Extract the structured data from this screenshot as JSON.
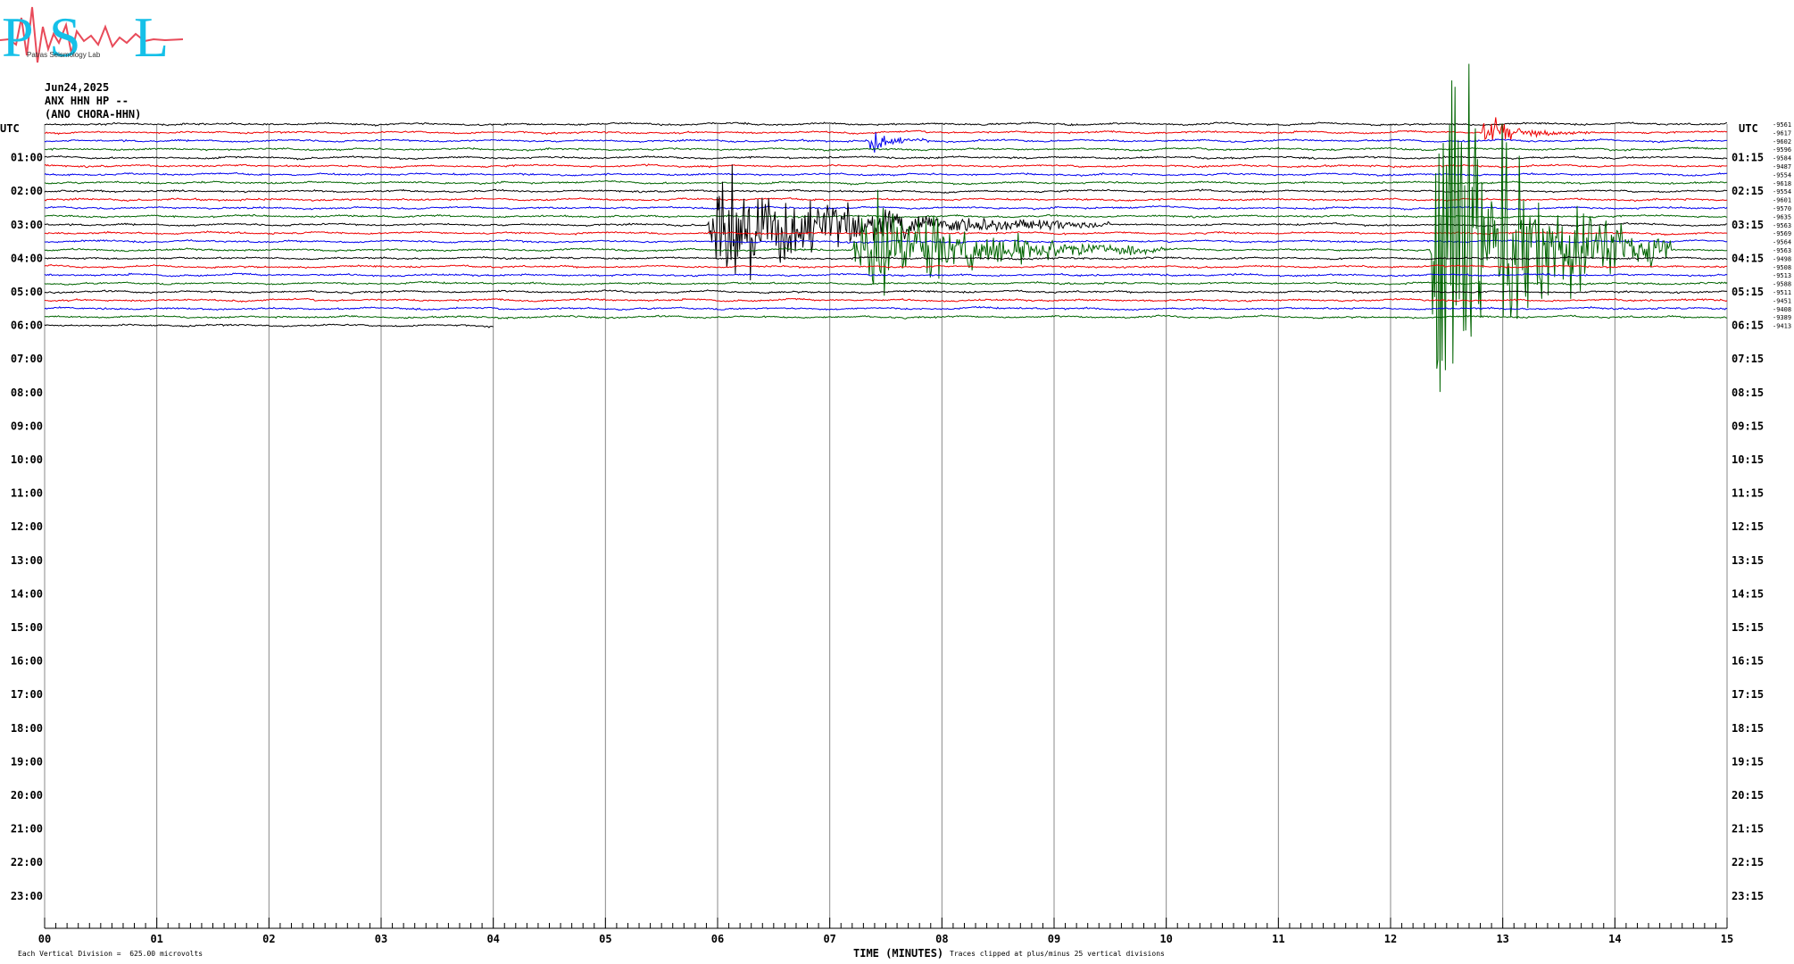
{
  "logo": {
    "letters": [
      "P",
      "S",
      "L"
    ],
    "caption": "Patras Seismology Lab",
    "colors": {
      "letters": "#15c0e8",
      "seismogram": "#e84b5a"
    }
  },
  "header": {
    "date": "Jun24,2025",
    "station_line": "ANX HHN HP --",
    "station_name": "(ANO CHORA-HHN)",
    "utc_label": "UTC"
  },
  "footer": {
    "scale_note": "Each Vertical Division =  625.00 microvolts",
    "xaxis_title": "TIME (MINUTES)",
    "clip_note": "Traces clipped at plus/minus 25 vertical divisions"
  },
  "chart_data": {
    "type": "line",
    "title": "",
    "xlabel": "TIME (MINUTES)",
    "xlim": [
      0,
      15
    ],
    "x_ticks": [
      "00",
      "01",
      "02",
      "03",
      "04",
      "05",
      "06",
      "07",
      "08",
      "09",
      "10",
      "11",
      "12",
      "13",
      "14",
      "15"
    ],
    "left_hour_labels": [
      "01:00",
      "02:00",
      "03:00",
      "04:00",
      "05:00",
      "06:00",
      "07:00",
      "08:00",
      "09:00",
      "10:00",
      "11:00",
      "12:00",
      "13:00",
      "14:00",
      "15:00",
      "16:00",
      "17:00",
      "18:00",
      "19:00",
      "20:00",
      "21:00",
      "22:00",
      "23:00"
    ],
    "right_hour_labels": [
      "01:15",
      "02:15",
      "03:15",
      "04:15",
      "05:15",
      "06:15",
      "07:15",
      "08:15",
      "09:15",
      "10:15",
      "11:15",
      "12:15",
      "13:15",
      "14:15",
      "15:15",
      "16:15",
      "17:15",
      "18:15",
      "19:15",
      "20:15",
      "21:15",
      "22:15",
      "23:15"
    ],
    "trace_colors": [
      "#000000",
      "#ee0000",
      "#0000ee",
      "#006400"
    ],
    "trace_count": 25,
    "last_trace_end_minute": 4.0,
    "trace_means": [
      "-9561",
      "-9617",
      "-9602",
      "-9596",
      "-9584",
      "-9487",
      "-9554",
      "-9618",
      "-9554",
      "-9601",
      "-9570",
      "-9635",
      "-9563",
      "-9569",
      "-9564",
      "-9563",
      "-9498",
      "-9508",
      "-9513",
      "-9588",
      "-9511",
      "-9451",
      "-9408",
      "-9389",
      "-9413"
    ],
    "events": [
      {
        "trace": 2,
        "minute_start": 7.35,
        "minute_end": 7.9,
        "amplitude": "moderate"
      },
      {
        "trace": 12,
        "minute_start": 5.9,
        "minute_end": 9.5,
        "amplitude": "large"
      },
      {
        "trace": 15,
        "minute_start": 7.2,
        "minute_end": 10.0,
        "amplitude": "large"
      },
      {
        "trace": 15,
        "minute_start": 12.35,
        "minute_end": 14.5,
        "amplitude": "clipped"
      },
      {
        "trace": 1,
        "minute_start": 12.8,
        "minute_end": 13.8,
        "amplitude": "moderate"
      }
    ]
  }
}
